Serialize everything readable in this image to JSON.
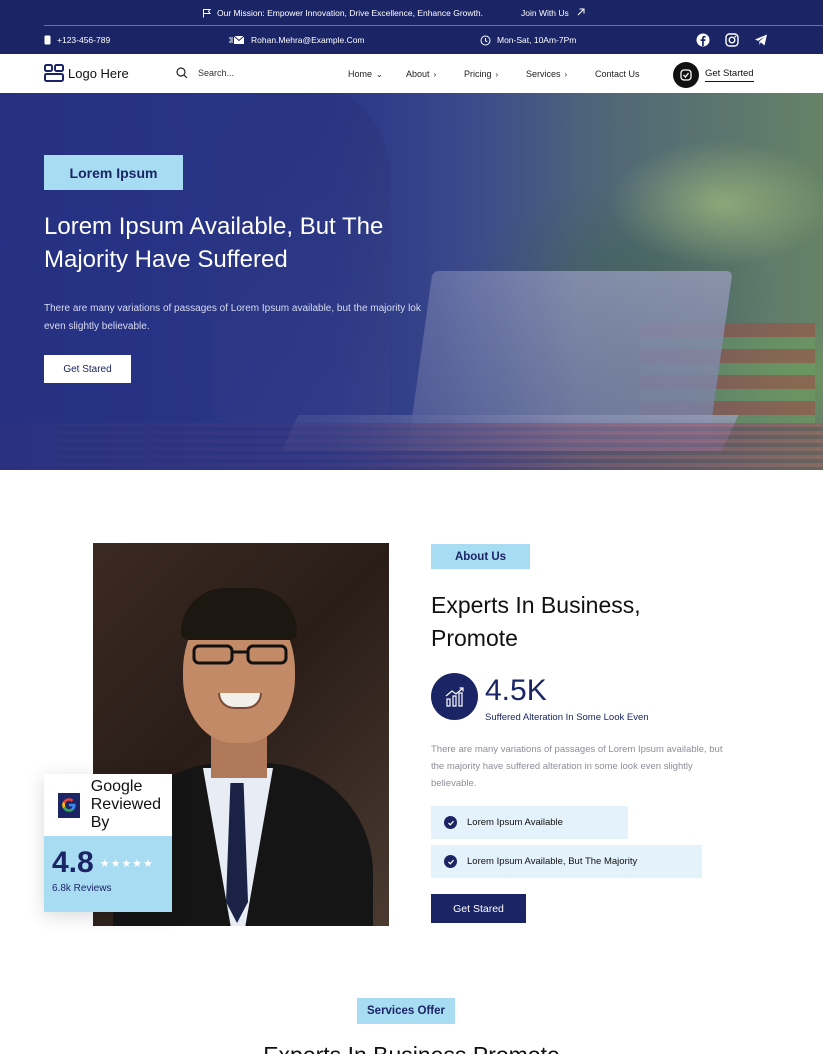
{
  "topbar": {
    "mission": "Our Mission: Empower Innovation, Drive Excellence, Enhance Growth.",
    "join": "Join With Us",
    "phone": "+123-456-789",
    "email": "Rohan.Mehra@Example.Com",
    "hours": "Mon-Sat, 10Am-7Pm",
    "social_icons": [
      "facebook-icon",
      "instagram-icon",
      "telegram-icon"
    ]
  },
  "nav": {
    "logo_text": "Logo Here",
    "search_placeholder": "Search...",
    "items": [
      {
        "label": "Home",
        "chevron": "⌄"
      },
      {
        "label": "About",
        "chevron": "›"
      },
      {
        "label": "Pricing",
        "chevron": "›"
      },
      {
        "label": "Services",
        "chevron": "›"
      },
      {
        "label": "Contact Us",
        "chevron": ""
      }
    ],
    "cta": "Get Started"
  },
  "hero": {
    "badge": "Lorem Ipsum",
    "title": "Lorem Ipsum Available, But The Majority Have Suffered",
    "description": "There are many variations of passages of Lorem Ipsum available, but the majority lok even slightly believable.",
    "button": "Get Stared"
  },
  "about": {
    "badge": "About Us",
    "title": "Experts In Business, Promote",
    "stat_value": "4.5K",
    "stat_label": "Suffered Alteration In Some Look Even",
    "description": "There are many variations of passages of Lorem Ipsum available, but the majority have suffered alteration in some look even slightly believable.",
    "checks": [
      "Lorem Ipsum Available",
      "Lorem Ipsum Available, But The Majority"
    ],
    "button": "Get Stared"
  },
  "review": {
    "line1": "Google",
    "line2": "Reviewed By",
    "rating": "4.8",
    "stars": "★★★★★",
    "count": "6.8k Reviews"
  },
  "services": {
    "badge": "Services Offer",
    "title": "Experts In Business Promote"
  },
  "colors": {
    "primary": "#1b2566",
    "accent": "#a8dcf3",
    "light_accent": "#e4f2fb"
  }
}
